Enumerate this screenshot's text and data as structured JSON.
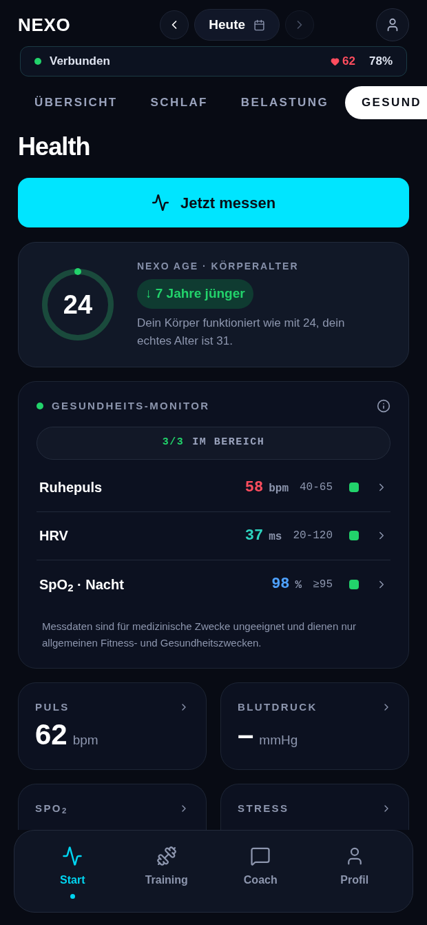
{
  "header": {
    "logo": "NEXO",
    "date": "Heute"
  },
  "status": {
    "connection": "Verbunden",
    "connected": true,
    "heart_rate": "62",
    "battery": "78%"
  },
  "tabs": [
    {
      "label": "ÜBERSICHT",
      "selected": false
    },
    {
      "label": "SCHLAF",
      "selected": false
    },
    {
      "label": "BELASTUNG",
      "selected": false
    },
    {
      "label": "GESUND",
      "selected": true
    }
  ],
  "title": "Health",
  "measure_button": "Jetzt messen",
  "age_card": {
    "age": "24",
    "label": "NEXO AGE · KÖRPERALTER",
    "badge": "↓ 7 Jahre jünger",
    "text": "Dein Körper funktioniert wie mit 24, dein echtes Alter ist 31."
  },
  "monitor": {
    "title": "GESUNDHEITS-MONITOR",
    "summary_count": "3/3",
    "summary_text": "IM BEREICH",
    "rows": [
      {
        "name": "Ruhepuls",
        "value": "58",
        "unit": "bpm",
        "range": "40-65",
        "color": "#ff4d5e",
        "in_range": true
      },
      {
        "name": "HRV",
        "value": "37",
        "unit": "ms",
        "range": "20-120",
        "color": "#2dd4bf",
        "in_range": true
      },
      {
        "name": "SpO$_{2}$ · Nacht",
        "value": "98",
        "unit": "%",
        "range": "≥95",
        "color": "#4ea1ff",
        "in_range": true
      }
    ],
    "disclaimer": "Messdaten sind für medizinische Zwecke ungeeignet und dienen nur allgemeinen Fitness- und Gesundheitszwecken."
  },
  "tiles": [
    {
      "label": "PULS",
      "value": "62",
      "unit": "bpm"
    },
    {
      "label": "BLUTDRUCK",
      "value": "–",
      "unit": "mmHg"
    },
    {
      "label": "SPO$_{2}$"
    },
    {
      "label": "STRESS"
    }
  ],
  "nav": [
    {
      "label": "Start",
      "kind": "pulse",
      "selected": true
    },
    {
      "label": "Training",
      "kind": "dumbbell",
      "selected": false
    },
    {
      "label": "Coach",
      "kind": "chat",
      "selected": false
    },
    {
      "label": "Profil",
      "kind": "user",
      "selected": false
    }
  ]
}
